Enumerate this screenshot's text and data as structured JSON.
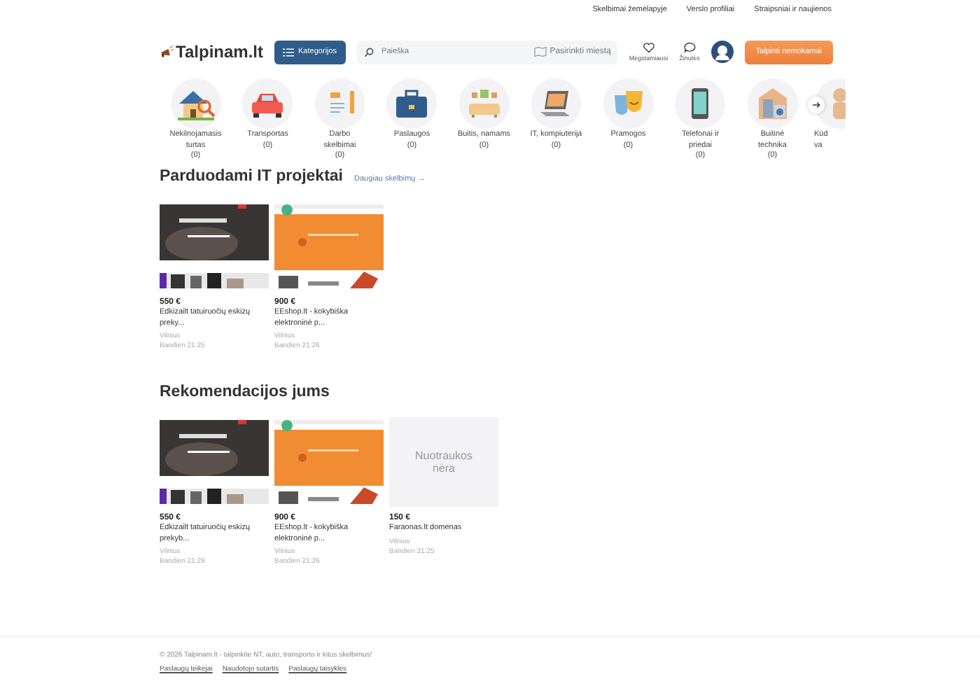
{
  "top_links": [
    "Skelbimai žemėlapyje",
    "Verslo profiliai",
    "Straipsniai ir naujienos"
  ],
  "header": {
    "logo": "Talpinam.lt",
    "categories_button": "Kategorijos",
    "search": {
      "placeholder": "Paieška"
    },
    "city_button": "Pasirinkti miestą",
    "favorites": "Mėgstamiausi",
    "messages": "Žinutės",
    "post_button": "Talpinti nemokamai"
  },
  "categories": [
    {
      "kind": "house",
      "lines": [
        "Nekilnojamasis",
        "turtas"
      ],
      "count": "(0)"
    },
    {
      "kind": "car",
      "lines": [
        "Transportas"
      ],
      "count": "(0)"
    },
    {
      "kind": "cv",
      "lines": [
        "Darbo",
        "skelbimai"
      ],
      "count": "(0)"
    },
    {
      "kind": "briefcase",
      "lines": [
        "Paslaugos"
      ],
      "count": "(0)"
    },
    {
      "kind": "sofa",
      "lines": [
        "Buitis, namams"
      ],
      "count": "(0)"
    },
    {
      "kind": "laptop",
      "lines": [
        "IT, kompiuterija"
      ],
      "count": "(0)"
    },
    {
      "kind": "masks",
      "lines": [
        "Pramogos"
      ],
      "count": "(0)"
    },
    {
      "kind": "phone",
      "lines": [
        "Telefonai ir",
        "priedai"
      ],
      "count": "(0)"
    },
    {
      "kind": "fridge",
      "lines": [
        "Buitinė",
        "technika"
      ],
      "count": "(0)"
    },
    {
      "kind": "child",
      "lines": [
        "Kūd",
        "va"
      ]
    }
  ],
  "sections": [
    {
      "title": "Parduodami IT projektai",
      "more_link": "Daugiau skelbimų →",
      "cards": [
        {
          "kind": "dark",
          "price": "550 €",
          "title": [
            "Edkizailt tatuiruočių eskizų",
            "preky..."
          ],
          "city": "Vilnius",
          "date": "Bandien 21:25"
        },
        {
          "kind": "orange",
          "price": "900 €",
          "title": [
            "EEshop.lt - kokybiška",
            "elektroninė p..."
          ],
          "city": "Vilnius",
          "date": "Bandien 21:26"
        }
      ]
    },
    {
      "title": "Rekomendacijos jums",
      "cards": [
        {
          "kind": "dark",
          "price": "550 €",
          "title": [
            "Edkizailt tatuiruočių eskizų",
            "prekyb..."
          ],
          "city": "Vilnius",
          "date": "Bandien 21:29"
        },
        {
          "kind": "orange",
          "price": "900 €",
          "title": [
            "EEshop.lt - kokybiška",
            "elektroninė p..."
          ],
          "city": "Vilnius",
          "date": "Bandien 21:26"
        },
        {
          "kind": "none",
          "no_photo": "Nuotraukos nėra",
          "price": "150 €",
          "title": [
            "Faraonas.lt domenas"
          ],
          "city": "Vilnius",
          "date": "Bandien 21:25"
        }
      ]
    }
  ],
  "footer": {
    "text": "© 2026 Talpinam.lt - talpinkite NT, auto, transporto ir kitus skelbimus!",
    "links": [
      "Paslaugų teikėjai",
      "Naudotojo sutartis",
      "Paslaugų taisyklės"
    ]
  }
}
